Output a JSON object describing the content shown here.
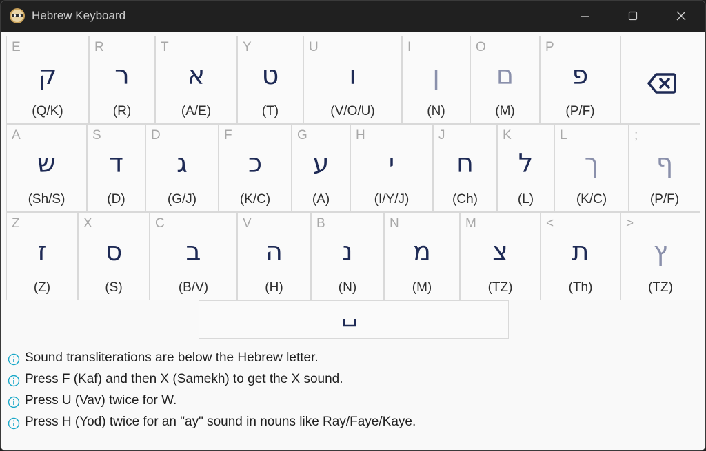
{
  "window": {
    "title": "Hebrew Keyboard"
  },
  "colors": {
    "letter": "#1e2a55",
    "final_letter": "#8a90ab",
    "info": "#1aa8c8"
  },
  "rows": [
    [
      {
        "key": "E",
        "hebrew": "ק",
        "translit": "(Q/K)"
      },
      {
        "key": "R",
        "hebrew": "ר",
        "translit": "(R)"
      },
      {
        "key": "T",
        "hebrew": "א",
        "translit": "(A/E)"
      },
      {
        "key": "Y",
        "hebrew": "ט",
        "translit": "(T)"
      },
      {
        "key": "U",
        "hebrew": "ו",
        "translit": "(V/O/U)"
      },
      {
        "key": "I",
        "hebrew": "ן",
        "translit": "(N)"
      },
      {
        "key": "O",
        "hebrew": "ם",
        "translit": "(M)"
      },
      {
        "key": "P",
        "hebrew": "פ",
        "translit": "(P/F)"
      }
    ],
    [
      {
        "key": "A",
        "hebrew": "ש",
        "translit": "(Sh/S)"
      },
      {
        "key": "S",
        "hebrew": "ד",
        "translit": "(D)"
      },
      {
        "key": "D",
        "hebrew": "ג",
        "translit": "(G/J)"
      },
      {
        "key": "F",
        "hebrew": "כ",
        "translit": "(K/C)"
      },
      {
        "key": "G",
        "hebrew": "ע",
        "translit": "(A)"
      },
      {
        "key": "H",
        "hebrew": "י",
        "translit": "(I/Y/J)"
      },
      {
        "key": "J",
        "hebrew": "ח",
        "translit": "(Ch)"
      },
      {
        "key": "K",
        "hebrew": "ל",
        "translit": "(L)"
      },
      {
        "key": "L",
        "hebrew": "ך",
        "translit": "(K/C)"
      },
      {
        "key": ";",
        "hebrew": "ף",
        "translit": "(P/F)"
      }
    ],
    [
      {
        "key": "Z",
        "hebrew": "ז",
        "translit": "(Z)"
      },
      {
        "key": "X",
        "hebrew": "ס",
        "translit": "(S)"
      },
      {
        "key": "C",
        "hebrew": "ב",
        "translit": "(B/V)"
      },
      {
        "key": "V",
        "hebrew": "ה",
        "translit": "(H)"
      },
      {
        "key": "B",
        "hebrew": "נ",
        "translit": "(N)"
      },
      {
        "key": "N",
        "hebrew": "מ",
        "translit": "(M)"
      },
      {
        "key": "M",
        "hebrew": "צ",
        "translit": "(TZ)"
      },
      {
        "key": "<",
        "hebrew": "ת",
        "translit": "(Th)"
      },
      {
        "key": ">",
        "hebrew": "ץ",
        "translit": "(TZ)"
      }
    ]
  ],
  "final_letters": [
    "ן",
    "ם",
    "ך",
    "ף",
    "ץ"
  ],
  "notes": [
    "Sound transliterations are below the Hebrew letter.",
    "Press F (Kaf) and then X (Samekh) to get the X sound.",
    "Press U (Vav) twice for W.",
    "Press H (Yod) twice for an \"ay\" sound in nouns like Ray/Faye/Kaye."
  ]
}
